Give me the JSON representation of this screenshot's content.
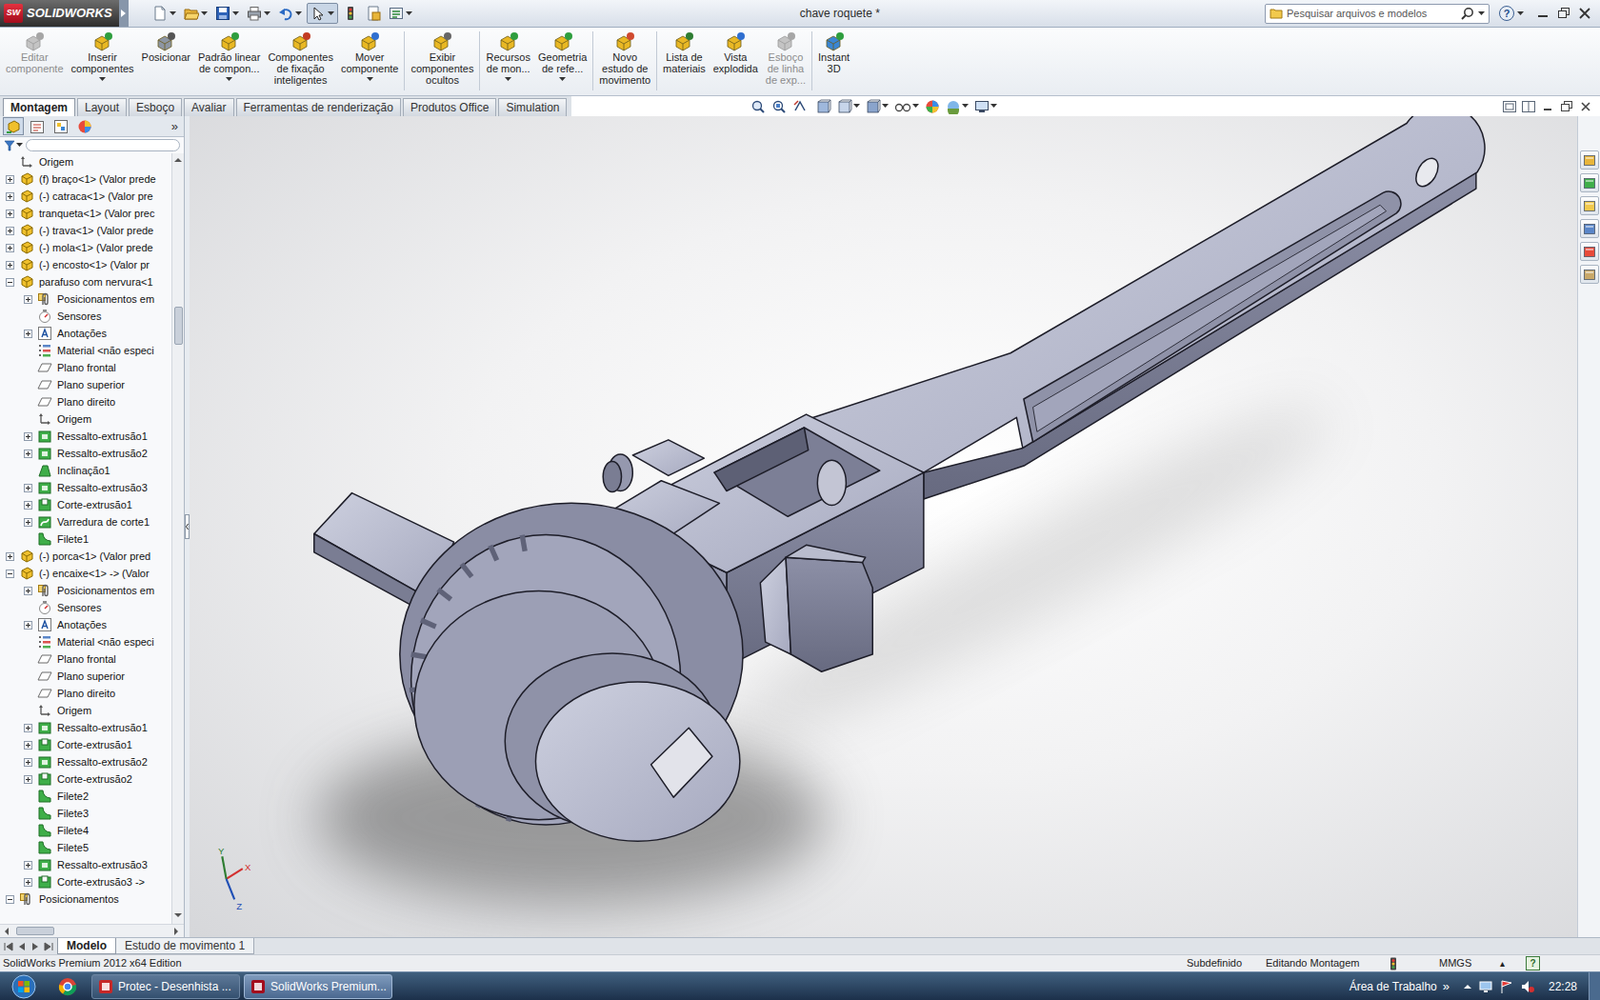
{
  "window": {
    "app": "SOLIDWORKS",
    "logo_mark": "SW",
    "title": "chave roquete *",
    "help": "?"
  },
  "search": {
    "placeholder": "Pesquisar arquivos e modelos"
  },
  "ribbon": [
    {
      "lines": [
        "Editar",
        "componente"
      ],
      "disabled": true,
      "dropdown": false,
      "separator_before": false
    },
    {
      "lines": [
        "Inserir",
        "componentes"
      ],
      "disabled": false,
      "dropdown": true,
      "separator_before": false
    },
    {
      "lines": [
        "Posicionar"
      ],
      "disabled": false,
      "dropdown": false,
      "separator_before": false
    },
    {
      "lines": [
        "Padrão linear",
        "de compon..."
      ],
      "disabled": false,
      "dropdown": true,
      "separator_before": false
    },
    {
      "lines": [
        "Componentes",
        "de fixação",
        "inteligentes"
      ],
      "disabled": false,
      "dropdown": false,
      "separator_before": false
    },
    {
      "lines": [
        "Mover",
        "componente"
      ],
      "disabled": false,
      "dropdown": true,
      "separator_before": false
    },
    {
      "lines": [
        "Exibir",
        "componentes",
        "ocultos"
      ],
      "disabled": false,
      "dropdown": false,
      "separator_before": true
    },
    {
      "lines": [
        "Recursos",
        "de mon..."
      ],
      "disabled": false,
      "dropdown": true,
      "separator_before": true
    },
    {
      "lines": [
        "Geometria",
        "de refe..."
      ],
      "disabled": false,
      "dropdown": true,
      "separator_before": false
    },
    {
      "lines": [
        "Novo",
        "estudo de",
        "movimento"
      ],
      "disabled": false,
      "dropdown": false,
      "separator_before": true
    },
    {
      "lines": [
        "Lista de",
        "materiais"
      ],
      "disabled": false,
      "dropdown": false,
      "separator_before": true
    },
    {
      "lines": [
        "Vista",
        "explodida"
      ],
      "disabled": false,
      "dropdown": false,
      "separator_before": false
    },
    {
      "lines": [
        "Esboço",
        "de linha",
        "de exp..."
      ],
      "disabled": true,
      "dropdown": false,
      "separator_before": false
    },
    {
      "lines": [
        "Instant",
        "3D"
      ],
      "disabled": false,
      "dropdown": false,
      "separator_before": true
    }
  ],
  "command_tabs": [
    {
      "label": "Montagem",
      "selected": true
    },
    {
      "label": "Layout",
      "selected": false
    },
    {
      "label": "Esboço",
      "selected": false
    },
    {
      "label": "Avaliar",
      "selected": false
    },
    {
      "label": "Ferramentas de renderização",
      "selected": false
    },
    {
      "label": "Produtos Office",
      "selected": false
    },
    {
      "label": "Simulation",
      "selected": false
    }
  ],
  "panel": {
    "more": "»"
  },
  "tree": [
    {
      "label": "Origem",
      "level": 0,
      "kind": "origin",
      "expandable": false,
      "expanded": false
    },
    {
      "label": "(f) braço<1> (Valor prede",
      "level": 0,
      "kind": "part",
      "expandable": true,
      "expanded": false
    },
    {
      "label": "(-) catraca<1> (Valor pre",
      "level": 0,
      "kind": "part",
      "expandable": true,
      "expanded": false
    },
    {
      "label": "tranqueta<1> (Valor prec",
      "level": 0,
      "kind": "part",
      "expandable": true,
      "expanded": false
    },
    {
      "label": "(-) trava<1> (Valor prede",
      "level": 0,
      "kind": "part",
      "expandable": true,
      "expanded": false
    },
    {
      "label": "(-) mola<1> (Valor prede",
      "level": 0,
      "kind": "part",
      "expandable": true,
      "expanded": false
    },
    {
      "label": "(-) encosto<1> (Valor pr",
      "level": 0,
      "kind": "part",
      "expandable": true,
      "expanded": false
    },
    {
      "label": "parafuso com nervura<1",
      "level": 0,
      "kind": "part",
      "expandable": true,
      "expanded": true
    },
    {
      "label": "Posicionamentos em",
      "level": 1,
      "kind": "mates",
      "expandable": true,
      "expanded": false
    },
    {
      "label": "Sensores",
      "level": 1,
      "kind": "sensors",
      "expandable": false,
      "expanded": false
    },
    {
      "label": "Anotações",
      "level": 1,
      "kind": "annotations",
      "expandable": true,
      "expanded": false
    },
    {
      "label": "Material <não especi",
      "level": 1,
      "kind": "material",
      "expandable": false,
      "expanded": false
    },
    {
      "label": "Plano frontal",
      "level": 1,
      "kind": "plane",
      "expandable": false,
      "expanded": false
    },
    {
      "label": "Plano superior",
      "level": 1,
      "kind": "plane",
      "expandable": false,
      "expanded": false
    },
    {
      "label": "Plano direito",
      "level": 1,
      "kind": "plane",
      "expandable": false,
      "expanded": false
    },
    {
      "label": "Origem",
      "level": 1,
      "kind": "origin",
      "expandable": false,
      "expanded": false
    },
    {
      "label": "Ressalto-extrusão1",
      "level": 1,
      "kind": "boss",
      "expandable": true,
      "expanded": false
    },
    {
      "label": "Ressalto-extrusão2",
      "level": 1,
      "kind": "boss",
      "expandable": true,
      "expanded": false
    },
    {
      "label": "Inclinação1",
      "level": 1,
      "kind": "draft",
      "expandable": false,
      "expanded": false
    },
    {
      "label": "Ressalto-extrusão3",
      "level": 1,
      "kind": "boss",
      "expandable": true,
      "expanded": false
    },
    {
      "label": "Corte-extrusão1",
      "level": 1,
      "kind": "cut",
      "expandable": true,
      "expanded": false
    },
    {
      "label": "Varredura de corte1",
      "level": 1,
      "kind": "sweep",
      "expandable": true,
      "expanded": false
    },
    {
      "label": "Filete1",
      "level": 1,
      "kind": "fillet",
      "expandable": false,
      "expanded": false
    },
    {
      "label": "(-) porca<1> (Valor pred",
      "level": 0,
      "kind": "part",
      "expandable": true,
      "expanded": false
    },
    {
      "label": "(-) encaixe<1> -> (Valor",
      "level": 0,
      "kind": "part",
      "expandable": true,
      "expanded": true
    },
    {
      "label": "Posicionamentos em",
      "level": 1,
      "kind": "mates",
      "expandable": true,
      "expanded": false
    },
    {
      "label": "Sensores",
      "level": 1,
      "kind": "sensors",
      "expandable": false,
      "expanded": false
    },
    {
      "label": "Anotações",
      "level": 1,
      "kind": "annotations",
      "expandable": true,
      "expanded": false
    },
    {
      "label": "Material <não especi",
      "level": 1,
      "kind": "material",
      "expandable": false,
      "expanded": false
    },
    {
      "label": "Plano frontal",
      "level": 1,
      "kind": "plane",
      "expandable": false,
      "expanded": false
    },
    {
      "label": "Plano superior",
      "level": 1,
      "kind": "plane",
      "expandable": false,
      "expanded": false
    },
    {
      "label": "Plano direito",
      "level": 1,
      "kind": "plane",
      "expandable": false,
      "expanded": false
    },
    {
      "label": "Origem",
      "level": 1,
      "kind": "origin",
      "expandable": false,
      "expanded": false
    },
    {
      "label": "Ressalto-extrusão1",
      "level": 1,
      "kind": "boss",
      "expandable": true,
      "expanded": false
    },
    {
      "label": "Corte-extrusão1",
      "level": 1,
      "kind": "cut",
      "expandable": true,
      "expanded": false
    },
    {
      "label": "Ressalto-extrusão2",
      "level": 1,
      "kind": "boss",
      "expandable": true,
      "expanded": false
    },
    {
      "label": "Corte-extrusão2",
      "level": 1,
      "kind": "cut",
      "expandable": true,
      "expanded": false
    },
    {
      "label": "Filete2",
      "level": 1,
      "kind": "fillet",
      "expandable": false,
      "expanded": false
    },
    {
      "label": "Filete3",
      "level": 1,
      "kind": "fillet",
      "expandable": false,
      "expanded": false
    },
    {
      "label": "Filete4",
      "level": 1,
      "kind": "fillet",
      "expandable": false,
      "expanded": false
    },
    {
      "label": "Filete5",
      "level": 1,
      "kind": "fillet",
      "expandable": false,
      "expanded": false
    },
    {
      "label": "Ressalto-extrusão3",
      "level": 1,
      "kind": "boss",
      "expandable": true,
      "expanded": false
    },
    {
      "label": "Corte-extrusão3 ->",
      "level": 1,
      "kind": "cut",
      "expandable": true,
      "expanded": false
    },
    {
      "label": "Posicionamentos",
      "level": 0,
      "kind": "mates",
      "expandable": true,
      "expanded": true
    }
  ],
  "triad": {
    "x": "X",
    "y": "Y",
    "z": "Z"
  },
  "bottom_tabs": [
    {
      "label": "Modelo",
      "selected": true
    },
    {
      "label": "Estudo de movimento 1",
      "selected": false
    }
  ],
  "status_bar": {
    "left": "SolidWorks Premium 2012 x64 Edition",
    "state": "Subdefinido",
    "mode": "Editando Montagem",
    "units": "MMGS",
    "units_arrow": "▴",
    "help": "?"
  },
  "taskbar": {
    "buttons": [
      {
        "label": "Protec - Desenhista ...",
        "selected": false,
        "kind": "pdf"
      },
      {
        "label": "SolidWorks Premium...",
        "selected": true,
        "kind": "solidworks"
      }
    ],
    "toolbar_label": "Área de Trabalho",
    "more": "»",
    "clock": "22:28"
  }
}
